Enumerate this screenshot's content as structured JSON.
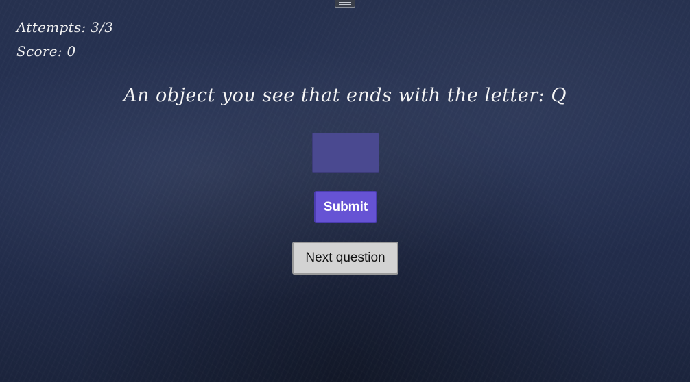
{
  "status": {
    "attempts_text": "Attempts: 3/3",
    "score_text": "Score: 0"
  },
  "question": {
    "text": "An object you see that ends with the letter: Q"
  },
  "answer": {
    "value": "",
    "placeholder": ""
  },
  "buttons": {
    "submit_label": "Submit",
    "next_label": "Next question"
  },
  "colors": {
    "board_background": "#243052",
    "input_fill": "#4a4990",
    "submit_fill": "#6653d4",
    "next_fill": "#d3d3d3",
    "chalk_text": "#f2f2f2"
  },
  "icons": {
    "top_handle": "menu-handle-icon"
  }
}
